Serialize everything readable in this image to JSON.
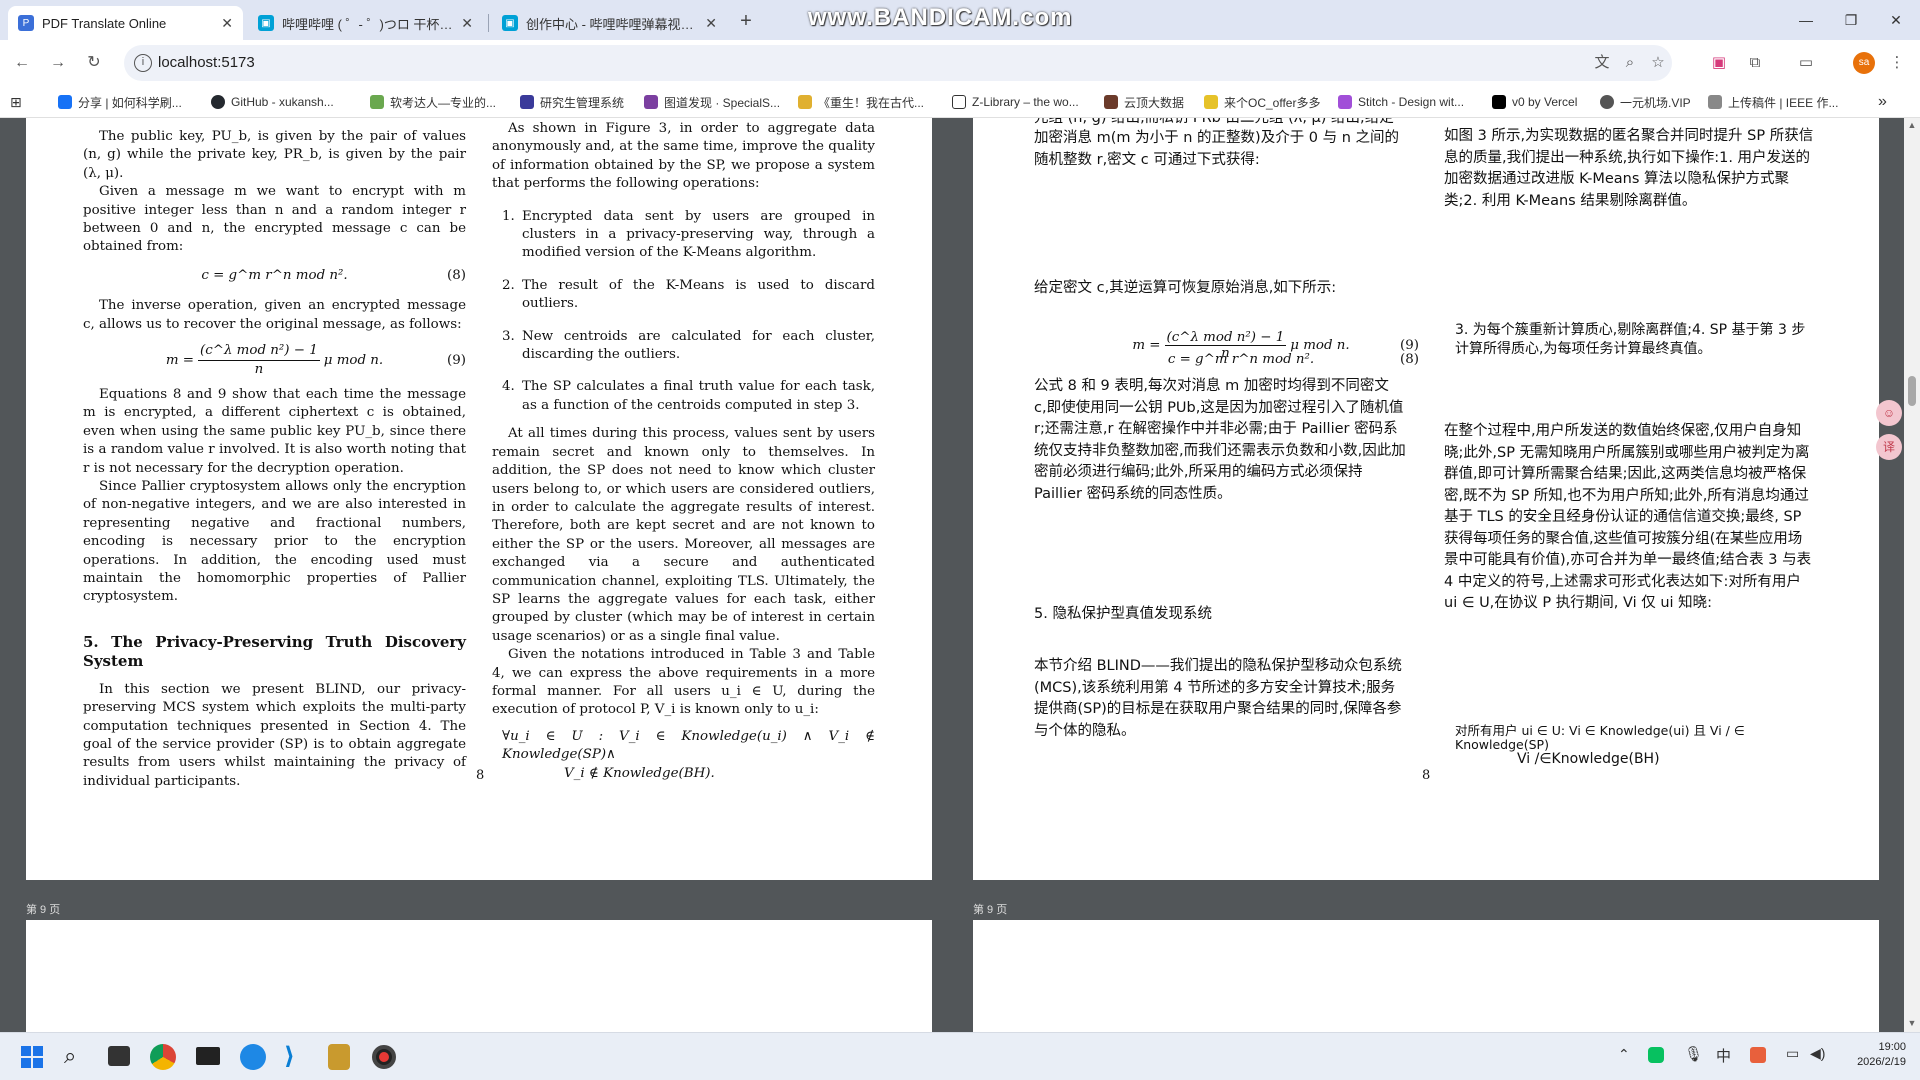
{
  "browser": {
    "tabs": [
      {
        "title": "PDF Translate Online",
        "active": true
      },
      {
        "title": "哔哩哔哩 ( ゜- ゜)つロ 干杯~-bi",
        "active": false
      },
      {
        "title": "创作中心 - 哔哩哔哩弹幕视频网",
        "active": false
      }
    ],
    "watermark": "www.BANDICAM.com",
    "address": "localhost:5173",
    "avatar_initials": "sa",
    "bookmarks": [
      "分享 | 如何科学刷...",
      "GitHub - xukansh...",
      "软考达人—专业的...",
      "研究生管理系统",
      "图道发现 · SpecialS...",
      "《重生！我在古代...",
      "Z-Library – the wo...",
      "云顶大数据",
      "来个OC_offer多多",
      "Stitch - Design wit...",
      "v0 by Vercel",
      "一元机场.VIP",
      "上传稿件 | IEEE 作..."
    ],
    "more_bookmarks": "»",
    "icons": [
      "back-icon",
      "forward-icon",
      "reload-icon",
      "translate-icon",
      "zoom-icon",
      "star-icon",
      "extension-icon",
      "puzzle-icon",
      "sidepanel-icon",
      "menu-icon"
    ]
  },
  "viewer": {
    "page_label_next": "第 9 页",
    "page_number": "8"
  },
  "original": {
    "col1": {
      "p1": "The public key, PU_b, is given by the pair of values (n, g) while the private key, PR_b, is given by the pair (λ, μ).",
      "p2": "Given a message m we want to encrypt with m positive integer less than n and a random integer r between 0 and n, the encrypted message c can be obtained from:",
      "eq8": "c = g^m r^n   mod n².",
      "eq8_num": "(8)",
      "p3": "The inverse operation, given an encrypted message c, allows us to recover the original message, as follows:",
      "eq9_lhs": "m =",
      "eq9_num_top": "(c^λ  mod n²) − 1",
      "eq9_num_bot": "n",
      "eq9_tail": "μ   mod n.",
      "eq9_num": "(9)",
      "p4": "Equations 8 and 9 show that each time the message m is encrypted, a different ciphertext c is obtained, even when using the same public key PU_b, since there is a random value r involved.  It is also worth noting that r is not necessary for the decryption operation.",
      "p5": "Since Pallier cryptosystem allows only the encryption of non-negative integers, and we are also interested in representing negative and fractional numbers, encoding is necessary prior to the encryption operations. In addition, the encoding used must maintain the homomorphic properties of Pallier cryptosystem.",
      "section": "5.  The Privacy-Preserving Truth Discovery System",
      "p6": "In this section we present BLIND, our privacy-preserving MCS system which exploits the multi-party computation techniques presented in Section 4. The goal of the service provider (SP) is to obtain aggregate results from users whilst maintaining the privacy of individual participants."
    },
    "col2": {
      "p1": "As shown in Figure 3, in order to aggregate data anonymously and, at the same time, improve the quality of information obtained by the SP, we propose a system that performs the following operations:",
      "steps": [
        {
          "n": "1.",
          "text": "Encrypted data sent by users are grouped in clusters in a privacy-preserving way, through a modified version of the K-Means algorithm."
        },
        {
          "n": "2.",
          "text": "The result of the K-Means is used to discard outliers."
        },
        {
          "n": "3.",
          "text": "New centroids are calculated for each cluster, discarding the outliers."
        },
        {
          "n": "4.",
          "text": "The SP calculates a final truth value for each task, as a function of the centroids computed in step 3."
        }
      ],
      "p2": "At all times during this process, values sent by users remain secret and known only to themselves.  In addition, the SP does not need to know which cluster users belong to, or which users are considered outliers, in order to calculate the aggregate results of interest.  Therefore, both are kept secret and are not known to either the SP or the users. Moreover, all messages are exchanged via a secure and authenticated communication channel, exploiting TLS. Ultimately, the SP learns the aggregate values for each task, either grouped by cluster (which may be of interest in certain usage scenarios) or as a single final value.",
      "p3": "Given the notations introduced in Table 3 and Table 4, we can express the above requirements in a more formal manner.  For all users u_i ∈ U, during the execution of protocol P, V_i is known only to u_i:",
      "formula_l1": "∀u_i ∈ U : V_i ∈ Knowledge(u_i) ∧ V_i ∉ Knowledge(SP)∧",
      "formula_l2": "V_i ∉ Knowledge(BH)."
    }
  },
  "translated": {
    "col1": {
      "top_cut": "元组 (n, g) 给出,而私钥 PRb 由二元组 (λ, μ) 给出;给定待",
      "p1": "加密消息 m(m 为小于 n 的正整数)及介于 0 与 n 之间的随机整数 r,密文 c 可通过下式获得:",
      "eq8": "c = g^m r^n   mod n².",
      "eq8_num": "(8)",
      "p2": "给定密文 c,其逆运算可恢复原始消息,如下所示:",
      "eq9_num": "(9)",
      "p3": "公式 8 和 9 表明,每次对消息 m 加密时均得到不同密文 c,即使使用同一公钥 PUb,这是因为加密过程引入了随机值 r;还需注意,r 在解密操作中并非必需;由于 Paillier 密码系统仅支持非负整数加密,而我们还需表示负数和小数,因此加密前必须进行编码;此外,所采用的编码方式必须保持 Paillier 密码系统的同态性质。",
      "section": "5. 隐私保护型真值发现系统",
      "p4": "本节介绍 BLIND——我们提出的隐私保护型移动众包系统(MCS),该系统利用第 4 节所述的多方安全计算技术;服务提供商(SP)的目标是在获取用户聚合结果的同时,保障各参与个体的隐私。"
    },
    "col2": {
      "p1": "如图 3 所示,为实现数据的匿名聚合并同时提升 SP 所获信息的质量,我们提出一种系统,执行如下操作:1. 用户发送的加密数据通过改进版 K-Means 算法以隐私保护方式聚类;2. 利用 K-Means 结果剔除离群值。",
      "p2": "3. 为每个簇重新计算质心,剔除离群值;4. SP 基于第 3 步计算所得质心,为每项任务计算最终真值。",
      "p3": "在整个过程中,用户所发送的数值始终保密,仅用户自身知晓;此外,SP 无需知晓用户所属簇别或哪些用户被判定为离群值,即可计算所需聚合结果;因此,这两类信息均被严格保密,既不为 SP 所知,也不为用户所知;此外,所有消息均通过基于 TLS 的安全且经身份认证的通信信道交换;最终, SP 获得每项任务的聚合值,这些值可按簇分组(在某些应用场景中可能具有价值),亦可合并为单一最终值;结合表 3 与表 4 中定义的符号,上述需求可形式化表达如下:对所有用户 ui ∈ U,在协议 P 执行期间, Vi 仅 ui 知晓:",
      "formula_l1": "对所有用户 ui ∈ U: Vi ∈ Knowledge(ui) 且 Vi / ∈ Knowledge(SP)",
      "formula_l2": "Vi /∈Knowledge(BH)"
    }
  },
  "taskbar": {
    "time": "19:00",
    "date": "2026/2/19"
  }
}
